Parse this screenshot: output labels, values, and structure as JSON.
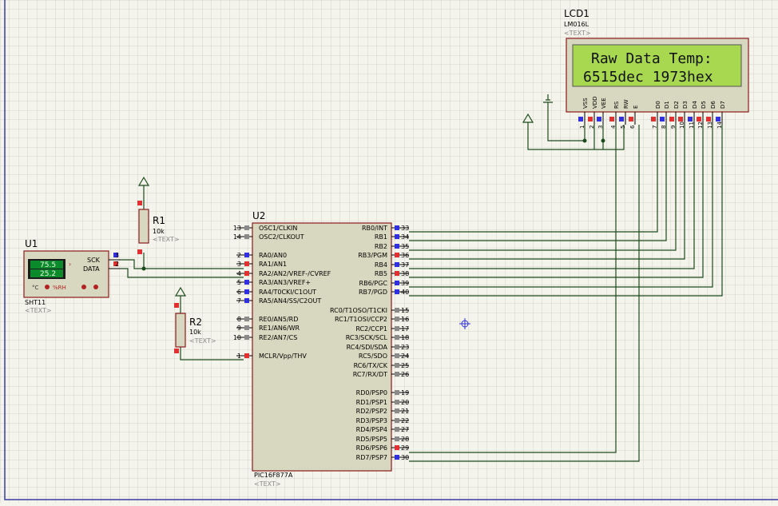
{
  "components": {
    "lcd": {
      "ref": "LCD1",
      "part": "LM016L",
      "tag": "<TEXT>",
      "line1": "Raw Data Temp:",
      "line2": "6515dec 1973hex",
      "pin_names": [
        "VSS",
        "VDD",
        "VEE",
        "RS",
        "RW",
        "E",
        "D0",
        "D1",
        "D2",
        "D3",
        "D4",
        "D5",
        "D6",
        "D7"
      ],
      "pin_numbers": [
        "1",
        "2",
        "3",
        "4",
        "5",
        "6",
        "7",
        "8",
        "9",
        "10",
        "11",
        "12",
        "13",
        "14"
      ]
    },
    "mcu": {
      "ref": "U2",
      "part": "PIC16F877A",
      "tag": "<TEXT>",
      "left_pins": [
        {
          "num": "13",
          "name": "OSC1/CLKIN"
        },
        {
          "num": "14",
          "name": "OSC2/CLKOUT"
        },
        {
          "num": "2",
          "name": "RA0/AN0"
        },
        {
          "num": "3",
          "name": "RA1/AN1"
        },
        {
          "num": "4",
          "name": "RA2/AN2/VREF-/CVREF"
        },
        {
          "num": "5",
          "name": "RA3/AN3/VREF+"
        },
        {
          "num": "6",
          "name": "RA4/T0CKI/C1OUT"
        },
        {
          "num": "7",
          "name": "RA5/AN4/SS/C2OUT"
        },
        {
          "num": "8",
          "name": "RE0/AN5/RD"
        },
        {
          "num": "9",
          "name": "RE1/AN6/WR"
        },
        {
          "num": "10",
          "name": "RE2/AN7/CS"
        },
        {
          "num": "1",
          "name": "MCLR/Vpp/THV"
        }
      ],
      "right_pins": [
        {
          "num": "33",
          "name": "RB0/INT"
        },
        {
          "num": "34",
          "name": "RB1"
        },
        {
          "num": "35",
          "name": "RB2"
        },
        {
          "num": "36",
          "name": "RB3/PGM"
        },
        {
          "num": "37",
          "name": "RB4"
        },
        {
          "num": "38",
          "name": "RB5"
        },
        {
          "num": "39",
          "name": "RB6/PGC"
        },
        {
          "num": "40",
          "name": "RB7/PGD"
        },
        {
          "num": "15",
          "name": "RC0/T1OSO/T1CKI"
        },
        {
          "num": "16",
          "name": "RC1/T1OSI/CCP2"
        },
        {
          "num": "17",
          "name": "RC2/CCP1"
        },
        {
          "num": "18",
          "name": "RC3/SCK/SCL"
        },
        {
          "num": "23",
          "name": "RC4/SDI/SDA"
        },
        {
          "num": "24",
          "name": "RC5/SDO"
        },
        {
          "num": "25",
          "name": "RC6/TX/CK"
        },
        {
          "num": "26",
          "name": "RC7/RX/DT"
        },
        {
          "num": "19",
          "name": "RD0/PSP0"
        },
        {
          "num": "20",
          "name": "RD1/PSP1"
        },
        {
          "num": "21",
          "name": "RD2/PSP2"
        },
        {
          "num": "22",
          "name": "RD3/PSP3"
        },
        {
          "num": "27",
          "name": "RD4/PSP4"
        },
        {
          "num": "28",
          "name": "RD5/PSP5"
        },
        {
          "num": "29",
          "name": "RD6/PSP6"
        },
        {
          "num": "30",
          "name": "RD7/PSP7"
        }
      ]
    },
    "sensor": {
      "ref": "U1",
      "part": "SHT11",
      "tag": "<TEXT>",
      "temp": "75.5",
      "humidity": "25.2",
      "units_c": "°C",
      "units_rh": "%RH",
      "sck": "SCK",
      "data": "DATA",
      "pin3": "3",
      "pin2": "2"
    },
    "r1": {
      "ref": "R1",
      "value": "10k",
      "tag": "<TEXT>"
    },
    "r2": {
      "ref": "R2",
      "value": "10k",
      "tag": "<TEXT>"
    }
  },
  "colors": {
    "background": "#f4f4ec",
    "grid": "#d6d6cc",
    "component_fill": "#d8d8c0",
    "component_stroke": "#8b1a1a",
    "wire": "#1c4a1c",
    "lcd_screen": "#a8d850",
    "pin_red": "#e03030",
    "pin_blue": "#3030e0"
  }
}
